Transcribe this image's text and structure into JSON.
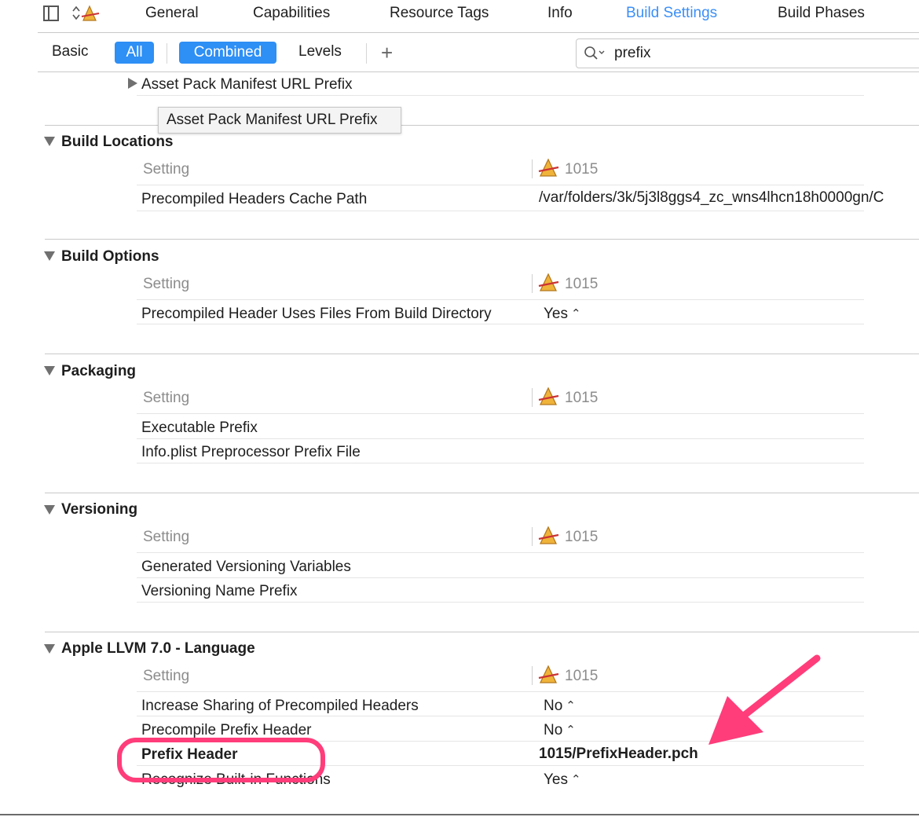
{
  "tabs": [
    "General",
    "Capabilities",
    "Resource Tags",
    "Info",
    "Build Settings",
    "Build Phases"
  ],
  "active_tab": "Build Settings",
  "filter": {
    "basic": "Basic",
    "all": "All",
    "combined": "Combined",
    "levels": "Levels",
    "add": "+",
    "search_value": "prefix"
  },
  "collapsed_row": "Asset Pack Manifest URL Prefix",
  "tooltip": "Asset Pack Manifest URL Prefix",
  "sections": [
    {
      "title": "Build Locations",
      "setting_header": "Setting",
      "target": "1015",
      "rows": [
        {
          "name": "Precompiled Headers Cache Path",
          "value": "/var/folders/3k/5j3l8ggs4_zc_wns4lhcn18h0000gn/C"
        }
      ]
    },
    {
      "title": "Build Options",
      "setting_header": "Setting",
      "target": "1015",
      "rows": [
        {
          "name": "Precompiled Header Uses Files From Build Directory",
          "value": "Yes"
        }
      ]
    },
    {
      "title": "Packaging",
      "setting_header": "Setting",
      "target": "1015",
      "rows": [
        {
          "name": "Executable Prefix",
          "value": ""
        },
        {
          "name": "Info.plist Preprocessor Prefix File",
          "value": ""
        }
      ]
    },
    {
      "title": "Versioning",
      "setting_header": "Setting",
      "target": "1015",
      "rows": [
        {
          "name": "Generated Versioning Variables",
          "value": ""
        },
        {
          "name": "Versioning Name Prefix",
          "value": ""
        }
      ]
    },
    {
      "title": "Apple LLVM 7.0 - Language",
      "setting_header": "Setting",
      "target": "1015",
      "rows": [
        {
          "name": "Increase Sharing of Precompiled Headers",
          "value": "No"
        },
        {
          "name": "Precompile Prefix Header",
          "value": "No"
        },
        {
          "name": "Prefix Header",
          "value": "1015/PrefixHeader.pch"
        },
        {
          "name": "Recognize Built-in Functions",
          "value": "Yes"
        }
      ]
    }
  ],
  "colors": {
    "accent": "#2e8ff5",
    "annotation": "#ff3d7b"
  }
}
